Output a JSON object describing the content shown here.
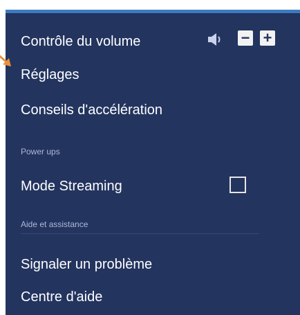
{
  "menu": {
    "volume_label": "Contrôle du volume",
    "volume_minus": "−",
    "volume_plus": "+",
    "settings_label": "Réglages",
    "tips_label": "Conseils d'accélération",
    "powerups_header": "Power ups",
    "streaming_label": "Mode Streaming",
    "streaming_checked": false,
    "help_header": "Aide et assistance",
    "report_label": "Signaler un problème",
    "help_center_label": "Centre d'aide"
  },
  "icons": {
    "volume": "speaker-icon",
    "pointer": "arrow-pointer-icon"
  },
  "colors": {
    "menu_bg": "#23345f",
    "accent_top": "#3c7bc2",
    "text": "#ffffff",
    "section_text": "#aeb9d6",
    "pointer": "#e8923a"
  }
}
